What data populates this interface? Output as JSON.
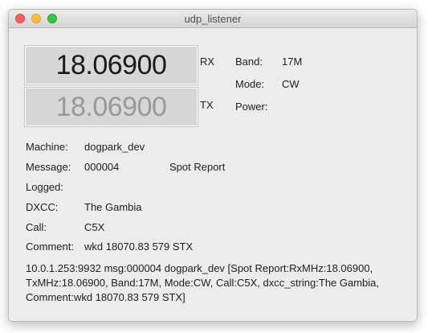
{
  "window": {
    "title": "udp_listener"
  },
  "frequency": {
    "rx_value": "18.06900",
    "rx_label": "RX",
    "tx_value": "18.06900",
    "tx_label": "TX"
  },
  "status": {
    "band_label": "Band:",
    "band_value": "17M",
    "mode_label": "Mode:",
    "mode_value": "CW",
    "power_label": "Power:",
    "power_value": ""
  },
  "details": {
    "machine_label": "Machine:",
    "machine_value": "dogpark_dev",
    "message_label": "Message:",
    "message_value": "000004",
    "message_type": "Spot Report",
    "logged_label": "Logged:",
    "logged_value": "",
    "dxcc_label": "DXCC:",
    "dxcc_value": "The Gambia",
    "call_label": "Call:",
    "call_value": "C5X",
    "comment_label": "Comment:",
    "comment_value": "wkd 18070.83 579 STX"
  },
  "log": {
    "text": "10.0.1.253:9932 msg:000004 dogpark_dev [Spot Report:RxMHz:18.06900,\nTxMHz:18.06900, Band:17M, Mode:CW, Call:C5X, dxcc_string:The Gambia,\nComment:wkd 18070.83 579 STX]"
  }
}
